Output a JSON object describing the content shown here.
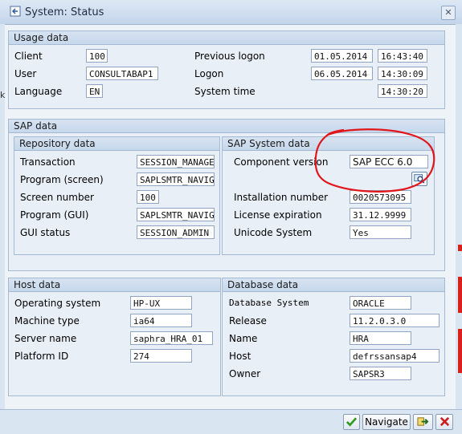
{
  "window": {
    "title": "System: Status",
    "close_glyph": "✕"
  },
  "background": {
    "left_char": "k"
  },
  "usage": {
    "title": "Usage data",
    "client_label": "Client",
    "client_value": "100",
    "user_label": "User",
    "user_value": "CONSULTABAP1",
    "language_label": "Language",
    "language_value": "EN",
    "prev_logon_label": "Previous logon",
    "prev_logon_date": "01.05.2014",
    "prev_logon_time": "16:43:40",
    "logon_label": "Logon",
    "logon_date": "06.05.2014",
    "logon_time": "14:30:09",
    "systime_label": "System time",
    "systime_value": "14:30:20"
  },
  "sap": {
    "title": "SAP data",
    "repo": {
      "title": "Repository data",
      "transaction_label": "Transaction",
      "transaction_value": "SESSION_MANAGER",
      "program_screen_label": "Program (screen)",
      "program_screen_value": "SAPLSMTR_NAVIGATION",
      "screen_number_label": "Screen number",
      "screen_number_value": "100",
      "program_gui_label": "Program (GUI)",
      "program_gui_value": "SAPLSMTR_NAVIGATION",
      "gui_status_label": "GUI status",
      "gui_status_value": "SESSION_ADMIN"
    },
    "system": {
      "title": "SAP System data",
      "component_label": "Component version",
      "component_value": "SAP ECC 6.0",
      "installation_label": "Installation number",
      "installation_value": "0020573095",
      "license_label": "License expiration",
      "license_value": "31.12.9999",
      "unicode_label": "Unicode System",
      "unicode_value": "Yes"
    }
  },
  "host": {
    "title": "Host data",
    "os_label": "Operating system",
    "os_value": "HP-UX",
    "machine_label": "Machine type",
    "machine_value": "ia64",
    "server_label": "Server name",
    "server_value": "saphra_HRA_01",
    "platform_label": "Platform ID",
    "platform_value": "274"
  },
  "database": {
    "title": "Database data",
    "system_label": "Database System",
    "system_value": "ORACLE",
    "release_label": "Release",
    "release_value": "11.2.0.3.0",
    "name_label": "Name",
    "name_value": "HRA",
    "host_label": "Host",
    "host_value": "defrssansap4",
    "owner_label": "Owner",
    "owner_value": "SAPSR3"
  },
  "footer": {
    "navigate_label": "Navigate"
  },
  "colors": {
    "annotation": "#e0161b",
    "accept": "#2e9b1f",
    "cancel": "#cc1f1f"
  }
}
